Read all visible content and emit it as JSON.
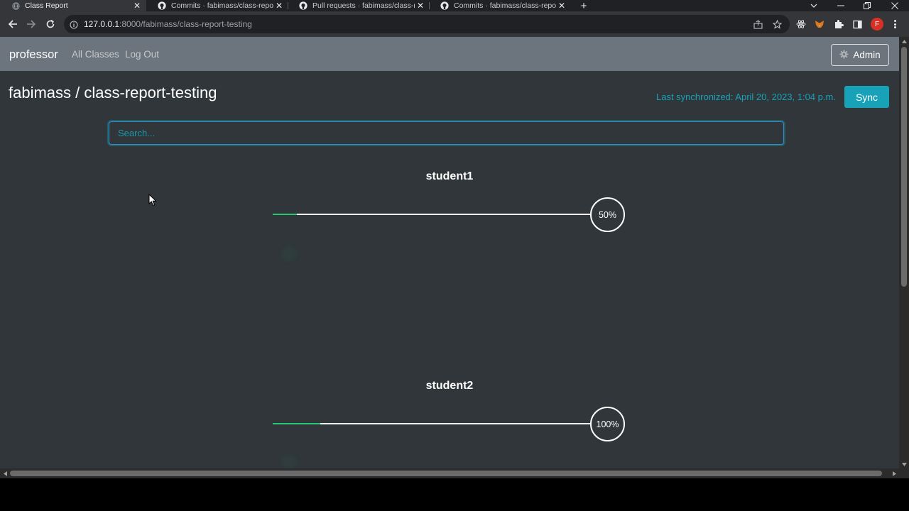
{
  "browser": {
    "tabs": [
      {
        "title": "Class Report",
        "active": true,
        "icon": "globe-icon"
      },
      {
        "title": "Commits · fabimass/class-report-",
        "active": false,
        "icon": "github-icon"
      },
      {
        "title": "Pull requests · fabimass/class-rep",
        "active": false,
        "icon": "github-icon"
      },
      {
        "title": "Commits · fabimass/class-report-",
        "active": false,
        "icon": "github-icon"
      }
    ],
    "url_host": "127.0.0.1",
    "url_rest": ":8000/fabimass/class-report-testing",
    "profile_initial": "F"
  },
  "nav": {
    "brand": "professor",
    "links": [
      "All Classes",
      "Log Out"
    ],
    "admin_label": "Admin"
  },
  "header": {
    "title": "fabimass / class-report-testing",
    "last_sync": "Last synchronized: April 20, 2023, 1:04 p.m.",
    "sync_label": "Sync"
  },
  "search": {
    "placeholder": "Search..."
  },
  "students": [
    {
      "name": "student1",
      "progress_label": "50%",
      "bar_fill": 0.075
    },
    {
      "name": "student2",
      "progress_label": "100%",
      "bar_fill": 0.15
    }
  ],
  "colors": {
    "navbar": "#6c757d",
    "page_bg": "#30363a",
    "accent": "#17a2b8",
    "progress": "#28c76f"
  }
}
